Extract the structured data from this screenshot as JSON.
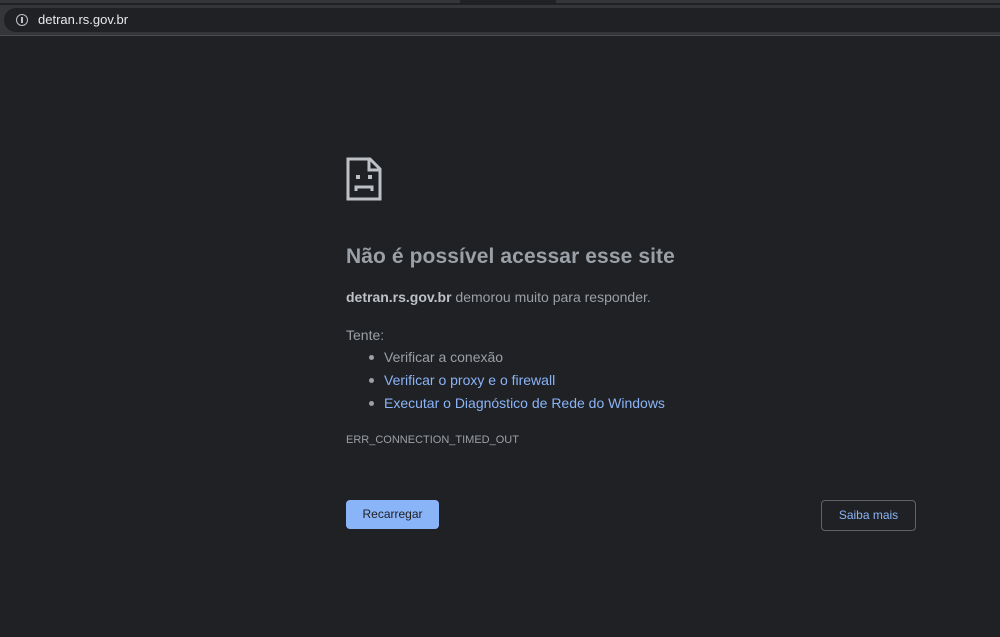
{
  "browser": {
    "url": "detran.rs.gov.br",
    "site_info_icon": "info-circle-icon"
  },
  "error_page": {
    "icon": "sad-page-icon",
    "title": "Não é possível acessar esse site",
    "summary_host": "detran.rs.gov.br",
    "summary_text": " demorou muito para responder.",
    "try_label": "Tente:",
    "suggestions": [
      {
        "label": "Verificar a conexão",
        "is_link": false
      },
      {
        "label": "Verificar o proxy e o firewall",
        "is_link": true
      },
      {
        "label": "Executar o Diagnóstico de Rede do Windows",
        "is_link": true
      }
    ],
    "error_code": "ERR_CONNECTION_TIMED_OUT",
    "reload_button": "Recarregar",
    "details_button": "Saiba mais"
  },
  "colors": {
    "background": "#202124",
    "text": "#9aa0a6",
    "link": "#8ab4f8",
    "primary_button": "#8ab4f8"
  }
}
